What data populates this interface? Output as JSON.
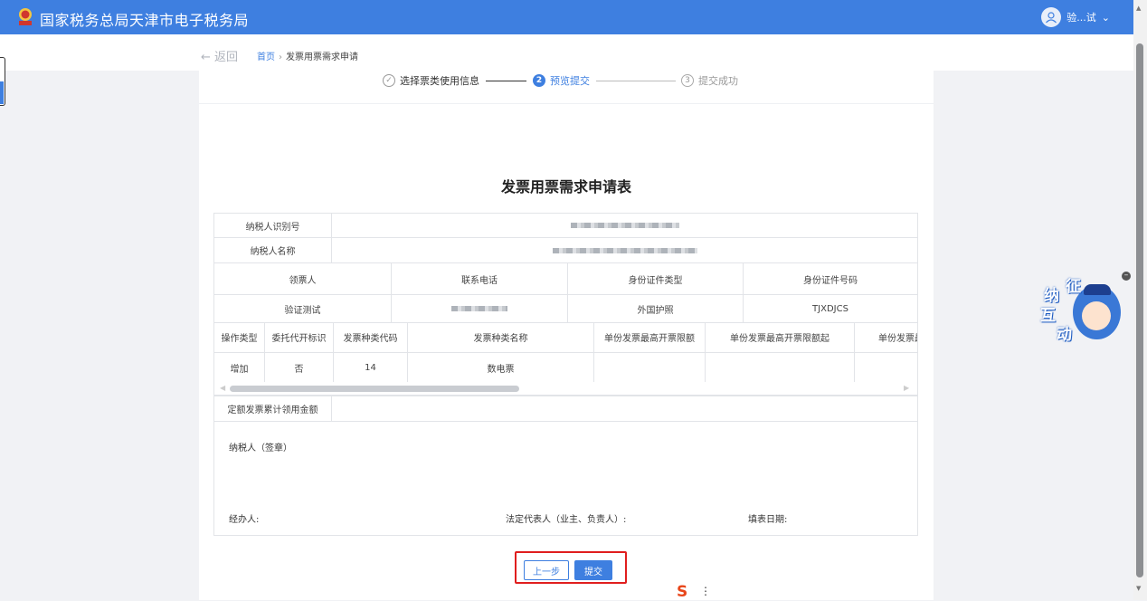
{
  "header": {
    "title": "国家税务总局天津市电子税务局",
    "user_name": "验...试",
    "user_caret": "⌄"
  },
  "breadcrumb": {
    "back_label": "← 返回",
    "home": "首页",
    "separator": "›",
    "current": "发票用票需求申请"
  },
  "steps": [
    {
      "icon": "✓",
      "label": "选择票类使用信息"
    },
    {
      "icon": "2",
      "label": "预览提交"
    },
    {
      "icon": "3",
      "label": "提交成功"
    }
  ],
  "form": {
    "title": "发票用票需求申请表",
    "taxpayer_id_label": "纳税人识别号",
    "taxpayer_name_label": "纳税人名称",
    "receiver_headers": [
      "领票人",
      "联系电话",
      "身份证件类型",
      "身份证件号码"
    ],
    "receiver_values": {
      "name": "验证测试",
      "id_type": "外国护照",
      "id_no": "TJXDJCS"
    },
    "invoice_headers": [
      "操作类型",
      "委托代开标识",
      "发票种类代码",
      "发票种类名称",
      "单份发票最高开票限额",
      "单份发票最高开票限额起",
      "单份发票最"
    ],
    "invoice_row": [
      "增加",
      "否",
      "14",
      "数电票",
      "",
      "",
      ""
    ],
    "fixed_amount_label": "定额发票累计领用金额",
    "signature_label": "纳税人（签章）",
    "handler_label": "经办人:",
    "legal_rep_label": "法定代表人（业主、负责人）:",
    "date_label": "填表日期:"
  },
  "buttons": {
    "prev": "上一步",
    "submit": "提交"
  },
  "widget": {
    "chars": [
      "征",
      "纳",
      "互",
      "动"
    ],
    "close": "–"
  },
  "ime": {
    "logo": "S",
    "more": "⋮"
  },
  "colors": {
    "primary": "#3e7fe0",
    "highlight": "#e01e1e"
  }
}
